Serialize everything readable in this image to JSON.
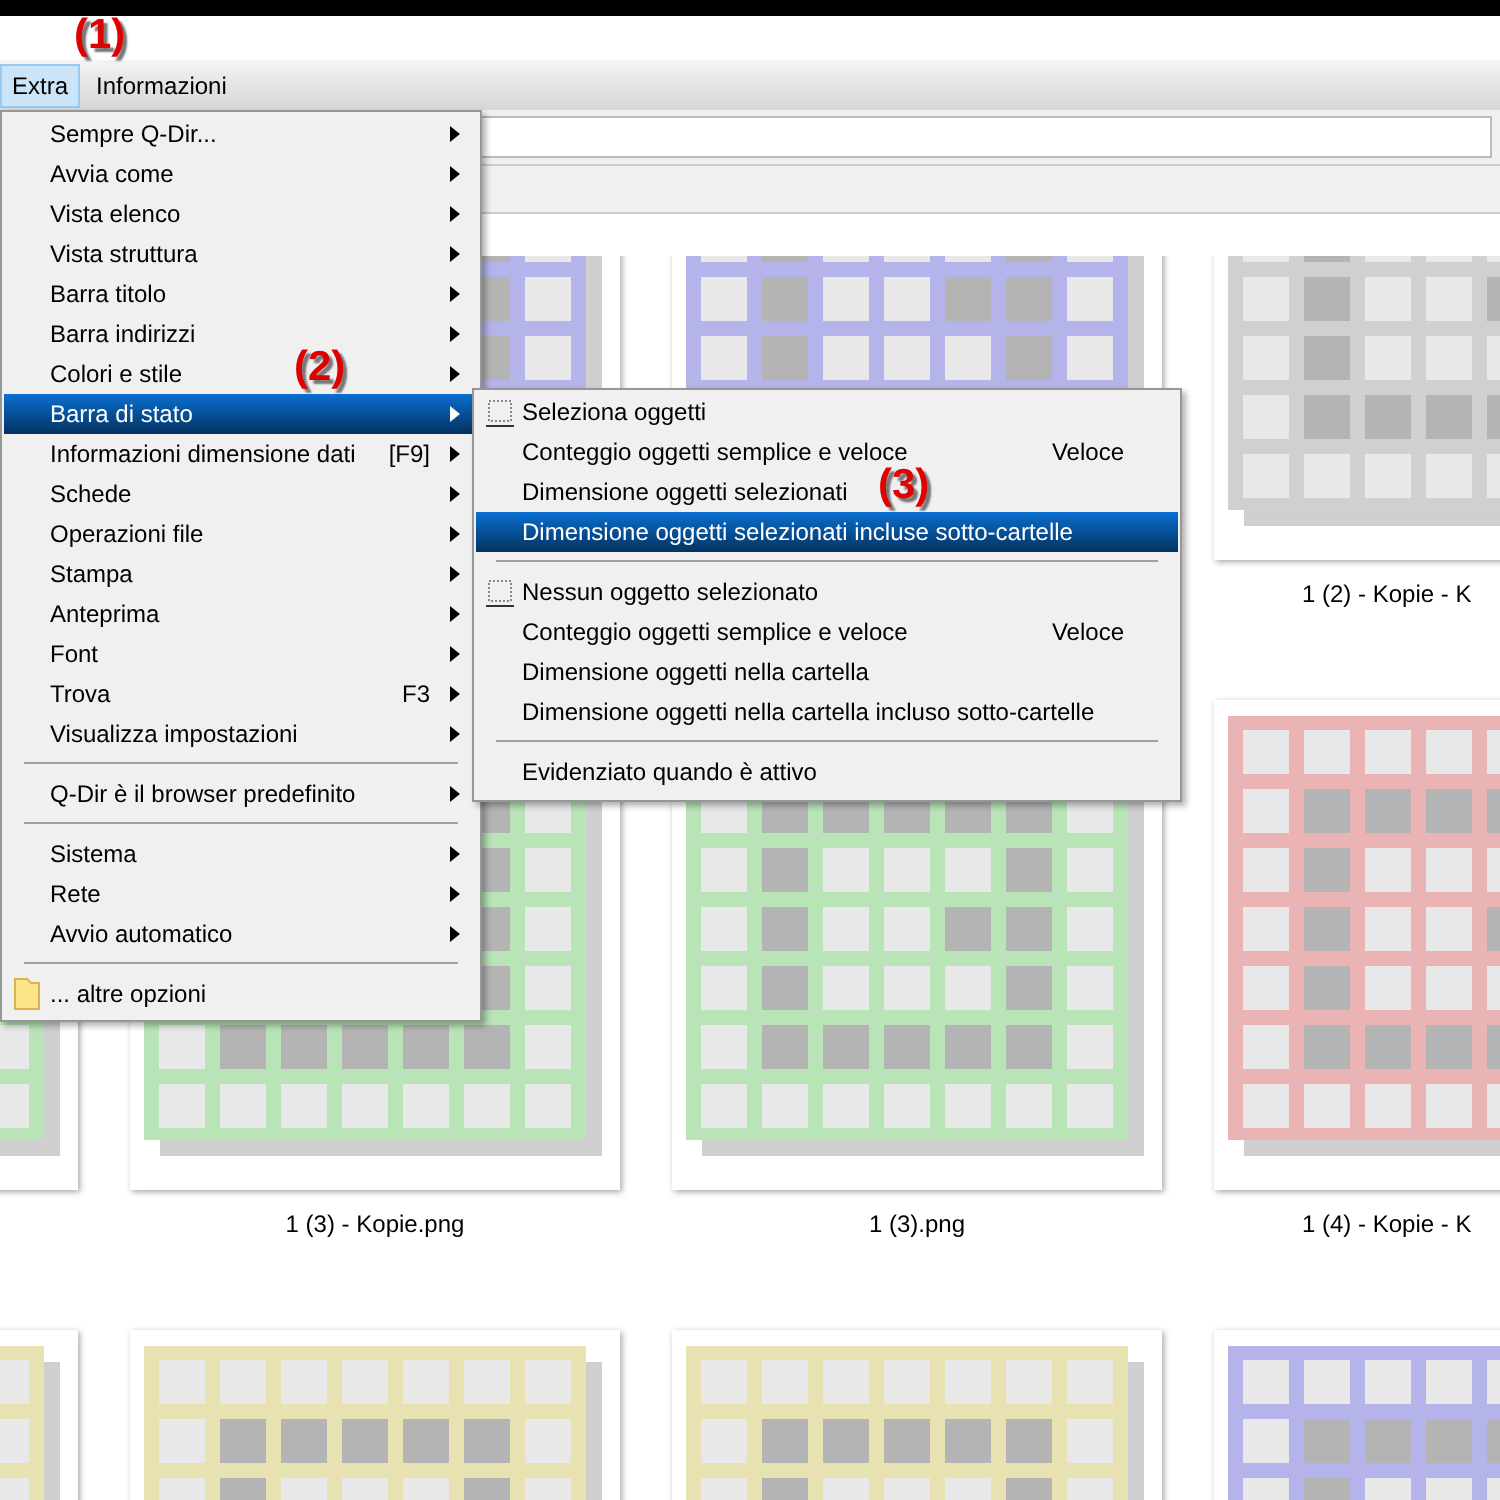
{
  "menu_bar": {
    "items": [
      {
        "label": "Extra",
        "selected": true
      },
      {
        "label": "Informazioni",
        "selected": false
      }
    ]
  },
  "annotations": [
    {
      "label": "(1)"
    }
  ],
  "menu": {
    "items": [
      {
        "kind": "item",
        "label": "Sempre Q-Dir...",
        "submenu": true,
        "selected": false
      },
      {
        "kind": "item",
        "label": "Avvia come",
        "submenu": true,
        "selected": false
      },
      {
        "kind": "item",
        "label": "Vista elenco",
        "submenu": true,
        "selected": false
      },
      {
        "kind": "item",
        "label": "Vista struttura",
        "submenu": true,
        "selected": false
      },
      {
        "kind": "item",
        "label": "Barra titolo",
        "submenu": true,
        "selected": false
      },
      {
        "kind": "item",
        "label": "Barra indirizzi",
        "submenu": true,
        "selected": false
      },
      {
        "kind": "item",
        "label": "Colori e stile",
        "submenu": true,
        "selected": false,
        "annotation": "(2)"
      },
      {
        "kind": "item",
        "label": "Barra di stato",
        "submenu": true,
        "selected": true
      },
      {
        "kind": "item",
        "label": "Informazioni dimensione dati",
        "shortcut": "[F9]",
        "submenu": true,
        "selected": false
      },
      {
        "kind": "item",
        "label": "Schede",
        "submenu": true,
        "selected": false
      },
      {
        "kind": "item",
        "label": "Operazioni file",
        "submenu": true,
        "selected": false
      },
      {
        "kind": "item",
        "label": "Stampa",
        "submenu": true,
        "selected": false
      },
      {
        "kind": "item",
        "label": "Anteprima",
        "submenu": true,
        "selected": false
      },
      {
        "kind": "item",
        "label": "Font",
        "submenu": true,
        "selected": false
      },
      {
        "kind": "item",
        "label": "Trova",
        "shortcut": "F3",
        "submenu": true,
        "selected": false
      },
      {
        "kind": "item",
        "label": "Visualizza impostazioni",
        "submenu": true,
        "selected": false
      },
      {
        "kind": "separator"
      },
      {
        "kind": "item",
        "label": "Q-Dir è il browser predefinito",
        "submenu": true,
        "selected": false
      },
      {
        "kind": "separator"
      },
      {
        "kind": "item",
        "label": "Sistema",
        "submenu": true,
        "selected": false
      },
      {
        "kind": "item",
        "label": "Rete",
        "submenu": true,
        "selected": false
      },
      {
        "kind": "item",
        "label": "Avvio automatico",
        "submenu": true,
        "selected": false
      },
      {
        "kind": "separator"
      },
      {
        "kind": "folder",
        "label": "... altre opzioni",
        "submenu": false,
        "selected": false
      }
    ]
  },
  "submenu": {
    "items": [
      {
        "kind": "checkbox",
        "label": "Seleziona oggetti",
        "checked": false,
        "selected": false
      },
      {
        "kind": "item",
        "label": "Conteggio oggetti semplice e veloce",
        "shortcut": "Veloce",
        "selected": false
      },
      {
        "kind": "item",
        "label": "Dimensione oggetti selezionati",
        "selected": false,
        "annotation": "(3)"
      },
      {
        "kind": "item",
        "label": "Dimensione oggetti selezionati incluse sotto-cartelle",
        "selected": true
      },
      {
        "kind": "separator"
      },
      {
        "kind": "checkbox",
        "label": "Nessun oggetto selezionato",
        "checked": false,
        "selected": false
      },
      {
        "kind": "item",
        "label": "Conteggio oggetti semplice e veloce",
        "shortcut": "Veloce",
        "selected": false
      },
      {
        "kind": "item",
        "label": "Dimensione oggetti nella cartella",
        "selected": false
      },
      {
        "kind": "item",
        "label": "Dimensione oggetti nella cartella incluso sotto-cartelle",
        "selected": false
      },
      {
        "kind": "separator"
      },
      {
        "kind": "item",
        "label": "Evidenziato quando è attivo",
        "selected": false
      }
    ]
  },
  "thumbnails": {
    "rows": [
      [
        "",
        {
          "color": "#b4b4ea"
        },
        {
          "color": "#b4b4ea"
        },
        {
          "color": "#d0d0d0",
          "label": "1 (2) - Kopie - K"
        }
      ],
      [
        {
          "color": "#b8e4b8"
        },
        {
          "color": "#b8e4b8",
          "label": "1 (3) - Kopie.png"
        },
        {
          "color": "#b8e4b8",
          "label": "1 (3).png"
        },
        {
          "color": "#ebb4b4",
          "label": "1 (4) - Kopie - K"
        }
      ],
      [
        {
          "color": "#e8e2b2"
        },
        {
          "color": "#e8e2b2"
        },
        {
          "color": "#e8e2b2"
        },
        {
          "color": "#b4b4ea"
        }
      ]
    ]
  }
}
